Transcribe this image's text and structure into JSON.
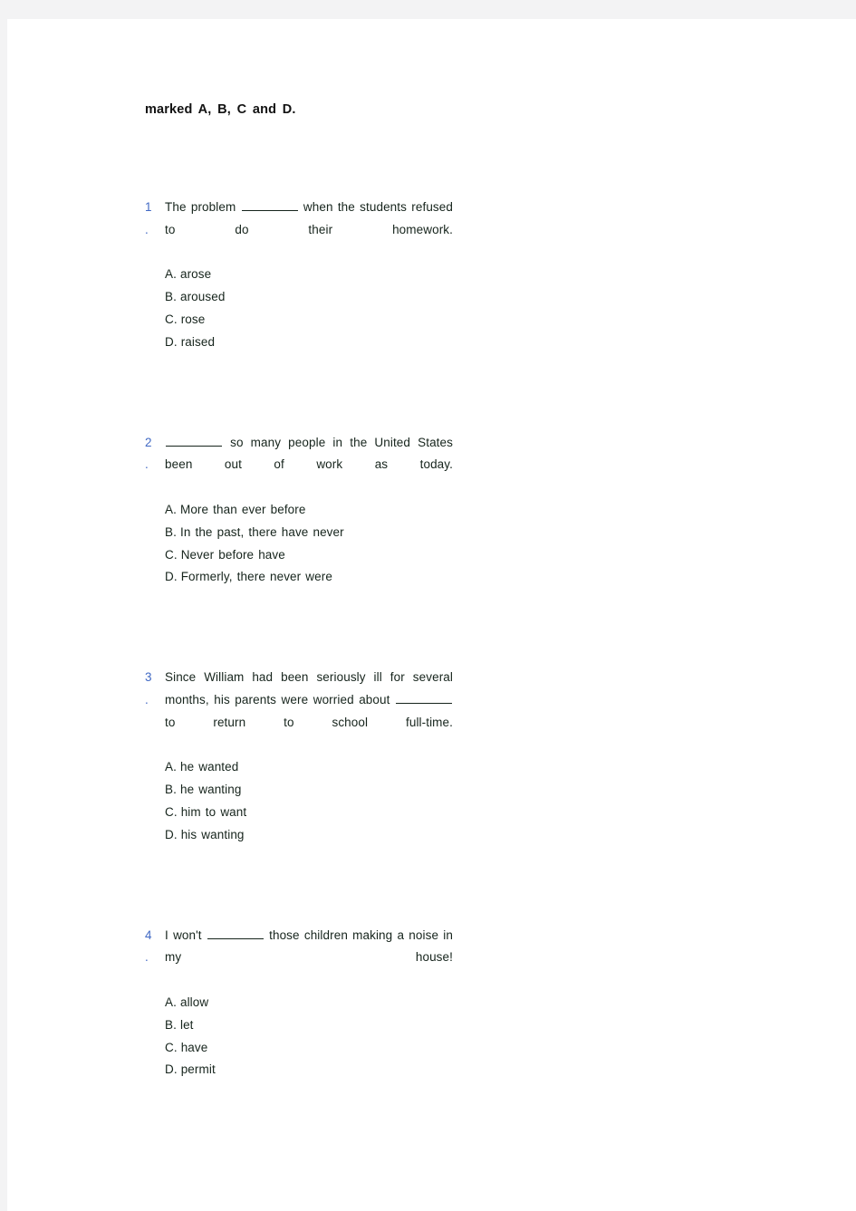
{
  "page": {
    "background_color": "#f3f3f4",
    "paper_color": "#ffffff",
    "number_color": "#4169c4",
    "text_color": "#16241c"
  },
  "header": {
    "text": "marked A, B, C and D."
  },
  "questions": [
    {
      "number": "1",
      "dot": ".",
      "text_before_blank": "The problem",
      "text_after_blank": "when the students refused to do their homework.",
      "options": [
        {
          "letter": "A.",
          "text": "arose"
        },
        {
          "letter": "B.",
          "text": "aroused"
        },
        {
          "letter": "C.",
          "text": "rose"
        },
        {
          "letter": "D.",
          "text": "raised"
        }
      ]
    },
    {
      "number": "2",
      "dot": ".",
      "text_before_blank": "",
      "text_after_blank": "so many people in the United States been out of work as today.",
      "options": [
        {
          "letter": "A.",
          "text": "More than ever before"
        },
        {
          "letter": "B.",
          "text": "In the past, there have never"
        },
        {
          "letter": "C.",
          "text": "Never before have"
        },
        {
          "letter": "D.",
          "text": "Formerly, there never were"
        }
      ]
    },
    {
      "number": "3",
      "dot": ".",
      "text_before_blank": "Since William had been seriously ill for several months, his parents were worried about",
      "text_after_blank": "to return to school full-time.",
      "options": [
        {
          "letter": "A.",
          "text": "he wanted"
        },
        {
          "letter": "B.",
          "text": "he wanting"
        },
        {
          "letter": "C.",
          "text": "him to want"
        },
        {
          "letter": "D.",
          "text": "his wanting"
        }
      ]
    },
    {
      "number": "4",
      "dot": ".",
      "text_before_blank": "I won't",
      "text_after_blank": "those children making a noise in my house!",
      "options": [
        {
          "letter": "A.",
          "text": "allow"
        },
        {
          "letter": "B.",
          "text": "let"
        },
        {
          "letter": "C.",
          "text": "have"
        },
        {
          "letter": "D.",
          "text": "permit"
        }
      ]
    }
  ]
}
